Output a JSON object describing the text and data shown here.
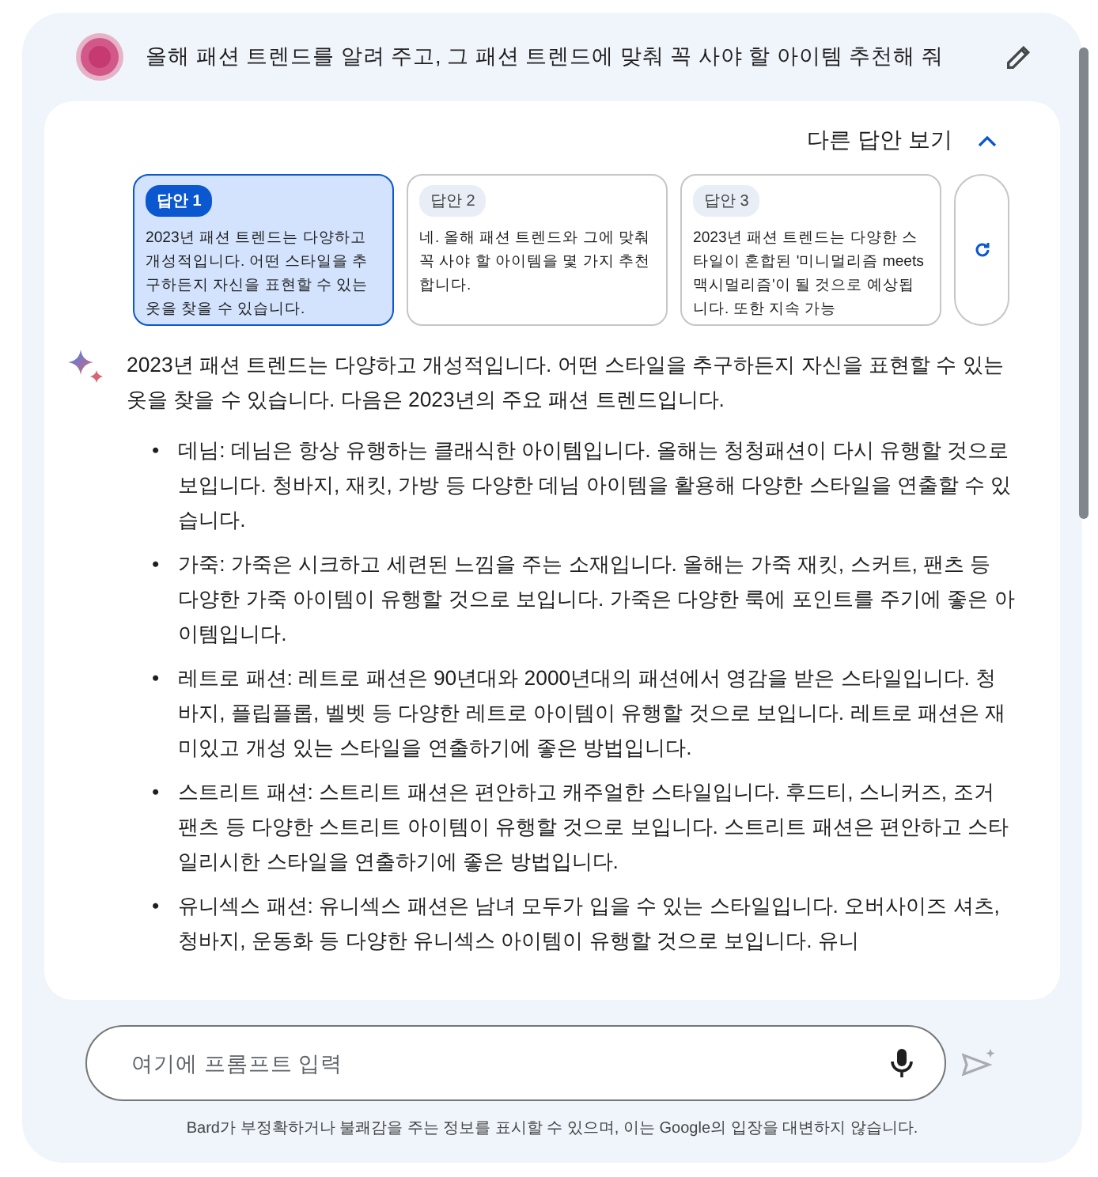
{
  "prompt": {
    "text": "올해 패션 트렌드를 알려 주고, 그 패션 트렌드에 맞춰 꼭 사야 할 아이템 추천해 줘"
  },
  "drafts_toggle": {
    "label": "다른 답안 보기",
    "expanded": true
  },
  "drafts": [
    {
      "badge": "답안 1",
      "text": "2023년 패션 트렌드는 다양하고 개성적입니다. 어떤 스타일을 추구하든지 자신을 표현할 수 있는 옷을 찾을 수 있습니다.",
      "selected": true
    },
    {
      "badge": "답안 2",
      "text": "네. 올해 패션 트렌드와 그에 맞춰 꼭 사야 할 아이템을 몇 가지 추천합니다.",
      "selected": false
    },
    {
      "badge": "답안 3",
      "text": "2023년 패션 트렌드는 다양한 스타일이 혼합된 '미니멀리즘 meets 맥시멀리즘'이 될 것으로 예상됩니다. 또한 지속 가능",
      "selected": false
    }
  ],
  "response": {
    "intro": "2023년 패션 트렌드는 다양하고 개성적입니다. 어떤 스타일을 추구하든지 자신을 표현할 수 있는 옷을 찾을 수 있습니다. 다음은 2023년의 주요 패션 트렌드입니다.",
    "bullet": "•",
    "items": [
      "데님: 데님은 항상 유행하는 클래식한 아이템입니다. 올해는 청청패션이 다시 유행할 것으로 보입니다. 청바지, 재킷, 가방 등 다양한 데님 아이템을 활용해 다양한 스타일을 연출할 수 있습니다.",
      "가죽: 가죽은 시크하고 세련된 느낌을 주는 소재입니다. 올해는 가죽 재킷, 스커트, 팬츠 등 다양한 가죽 아이템이 유행할 것으로 보입니다. 가죽은 다양한 룩에 포인트를 주기에 좋은 아이템입니다.",
      "레트로 패션: 레트로 패션은 90년대와 2000년대의 패션에서 영감을 받은 스타일입니다. 청바지, 플립플롭, 벨벳 등 다양한 레트로 아이템이 유행할 것으로 보입니다. 레트로 패션은 재미있고 개성 있는 스타일을 연출하기에 좋은 방법입니다.",
      "스트리트 패션: 스트리트 패션은 편안하고 캐주얼한 스타일입니다. 후드티, 스니커즈, 조거 팬츠 등 다양한 스트리트 아이템이 유행할 것으로 보입니다. 스트리트 패션은 편안하고 스타일리시한 스타일을 연출하기에 좋은 방법입니다.",
      "유니섹스 패션: 유니섹스 패션은 남녀 모두가 입을 수 있는 스타일입니다. 오버사이즈 셔츠, 청바지, 운동화 등 다양한 유니섹스 아이템이 유행할 것으로 보입니다. 유니"
    ]
  },
  "input": {
    "placeholder": "여기에 프롬프트 입력"
  },
  "disclaimer": "Bard가 부정확하거나 불쾌감을 주는 정보를 표시할 수 있으며, 이는 Google의 입장을 대변하지 않습니다."
}
